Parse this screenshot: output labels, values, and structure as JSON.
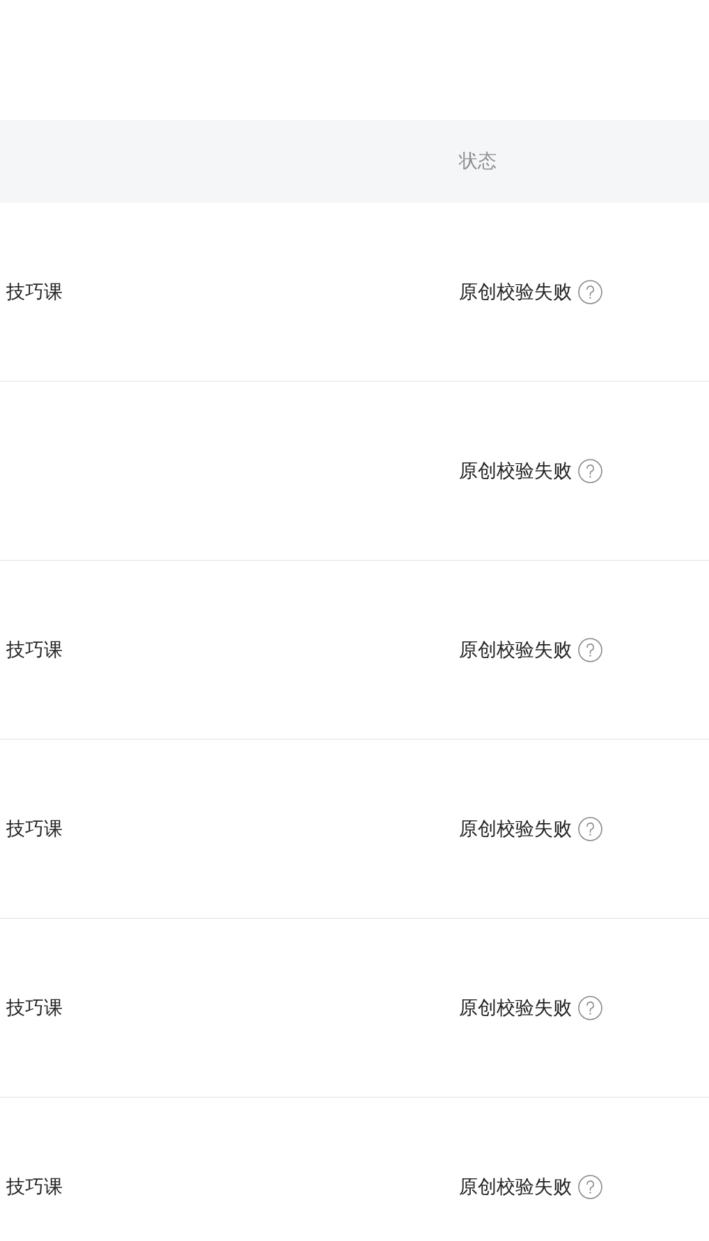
{
  "table": {
    "status_heading": "状态",
    "rows": [
      {
        "column_1": "技巧课",
        "status": "原创校验失败"
      },
      {
        "status": "原创校验失败"
      },
      {
        "column_1": "技巧课",
        "status": "原创校验失败"
      },
      {
        "column_1": "技巧课",
        "status": "原创校验失败"
      },
      {
        "column_1": "技巧课",
        "status": "原创校验失败"
      },
      {
        "column_1": "技巧课",
        "status": "原创校验失败"
      }
    ]
  }
}
